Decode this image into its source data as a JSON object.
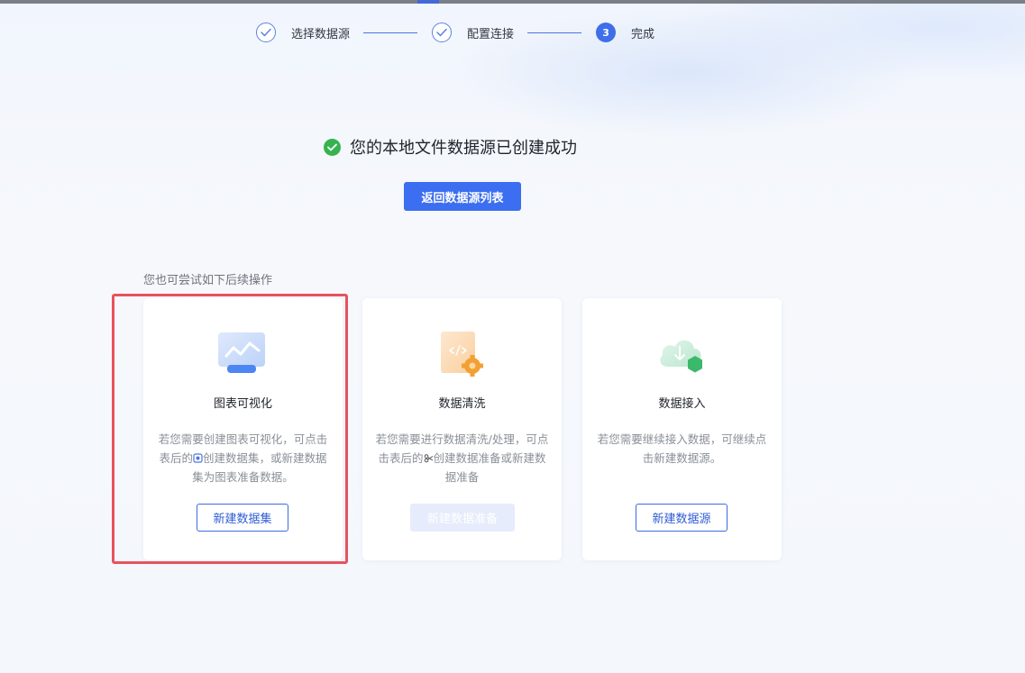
{
  "steps": [
    {
      "label": "选择数据源",
      "status": "done"
    },
    {
      "label": "配置连接",
      "status": "done"
    },
    {
      "label": "完成",
      "status": "current",
      "number": "3"
    }
  ],
  "success": {
    "message": "您的本地文件数据源已创建成功",
    "back_button": "返回数据源列表"
  },
  "hint": "您也可尝试如下后续操作",
  "cards": [
    {
      "title": "图表可视化",
      "desc_part1": "若您需要创建图表可视化，可点击表后的",
      "desc_part2": "创建数据集，或新建数据集为图表准备数据。",
      "button": "新建数据集",
      "icon": "chart-visualization-icon"
    },
    {
      "title": "数据清洗",
      "desc_part1": "若您需要进行数据清洗/处理，可点击表后的",
      "desc_part2": "创建数据准备或新建数据准备",
      "button": "新建数据准备",
      "icon": "data-cleaning-icon"
    },
    {
      "title": "数据接入",
      "desc": "若您需要继续接入数据，可继续点击新建数据源。",
      "button": "新建数据源",
      "icon": "data-ingestion-icon"
    }
  ],
  "colors": {
    "primary": "#3b6ef0",
    "success": "#36b34f",
    "highlight": "#e8525e"
  }
}
